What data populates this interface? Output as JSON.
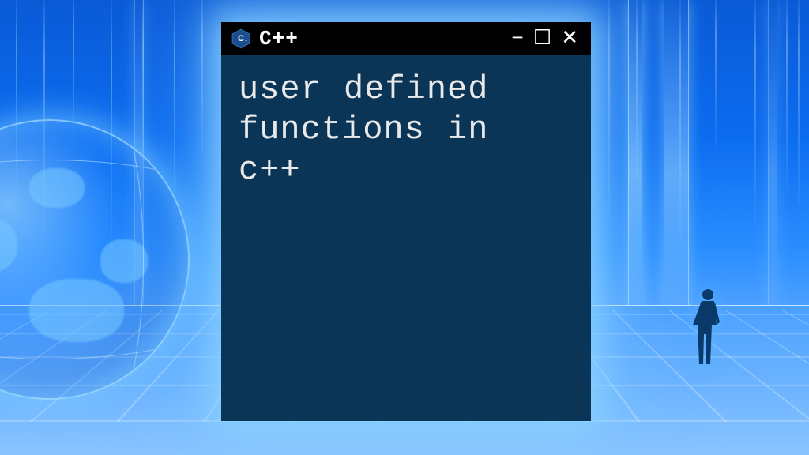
{
  "window": {
    "title": "C++",
    "content": "user defined\nfunctions in\nc++",
    "controls": {
      "min": "−",
      "max": "☐",
      "close": "✕"
    },
    "logo_label": "C++"
  },
  "colors": {
    "titlebar_bg": "#000000",
    "body_bg": "#0b3556",
    "text": "#e9e9e9",
    "glow": "#8cd2ff"
  }
}
